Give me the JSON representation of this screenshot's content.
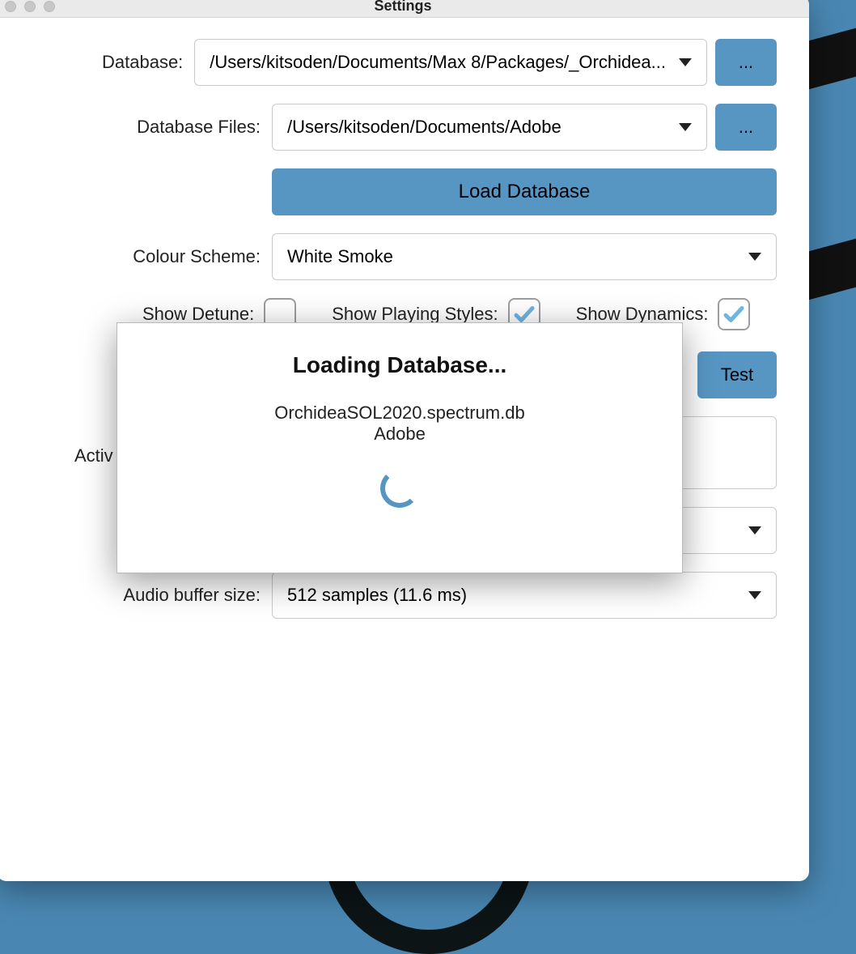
{
  "window": {
    "title": "Settings"
  },
  "labels": {
    "database": "Database:",
    "databaseFiles": "Database Files:",
    "colourScheme": "Colour Scheme:",
    "showDetune": "Show Detune:",
    "showPlayingStyles": "Show Playing Styles:",
    "showDynamics": "Show Dynamics:",
    "activeCut": "Activ",
    "bufferSize": "Audio buffer size:"
  },
  "fields": {
    "database": "/Users/kitsoden/Documents/Max 8/Packages/_Orchidea...",
    "databaseFiles": "/Users/kitsoden/Documents/Adobe",
    "colourScheme": "White Smoke",
    "hiddenSelect": "",
    "bufferSize": "512 samples (11.6 ms)"
  },
  "buttons": {
    "browse": "...",
    "loadDatabase": "Load Database",
    "test": "Test"
  },
  "checkboxes": {
    "showDetune": false,
    "showPlayingStyles": true,
    "showDynamics": true
  },
  "modal": {
    "title": "Loading Database...",
    "line1": "OrchideaSOL2020.spectrum.db",
    "line2": "Adobe"
  }
}
